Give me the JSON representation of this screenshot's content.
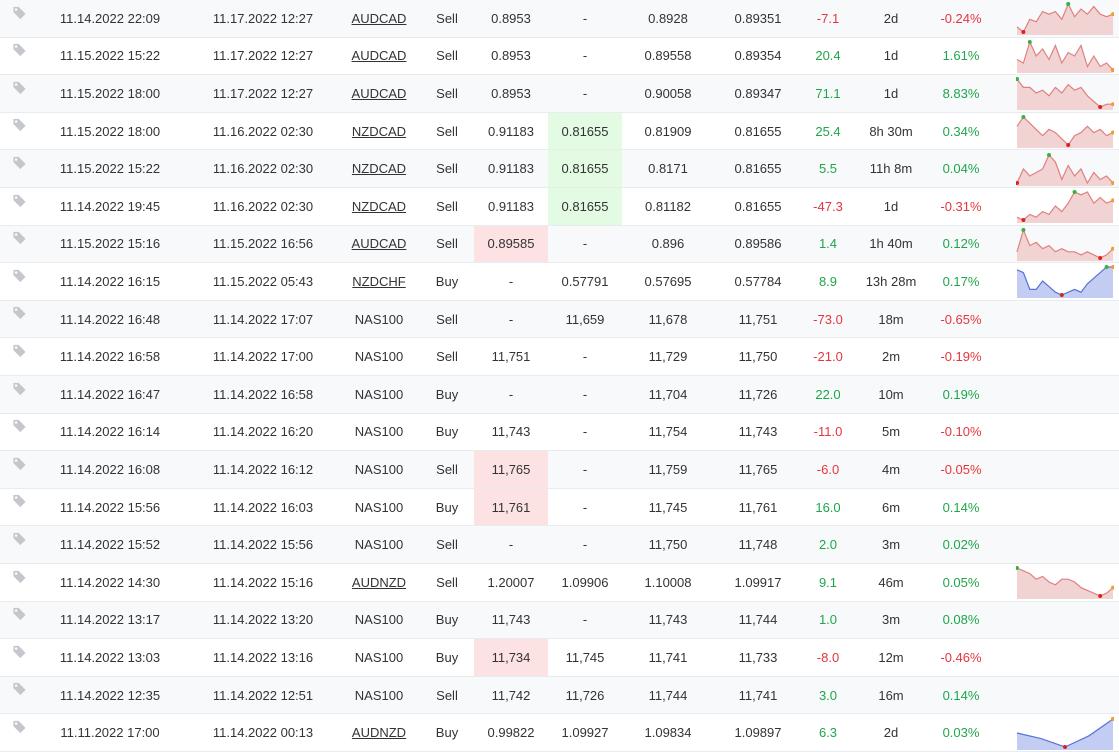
{
  "colors": {
    "positive": "#1fa64a",
    "negative": "#e5363d",
    "sl_highlight": "#fde2e3",
    "tp_highlight": "#e3fbe3",
    "spark_sell_fill": "#f2d3d3",
    "spark_sell_line": "#e08080",
    "spark_buy_fill": "#c3ccf2",
    "spark_buy_line": "#5a72d8",
    "spark_max_dot": "#3cb043",
    "spark_min_dot": "#e02020",
    "spark_end_dot": "#f0a030"
  },
  "row_icon": "tag-icon",
  "trades": [
    {
      "open_date": "11.14.2022 22:09",
      "close_date": "11.17.2022 12:27",
      "symbol": "AUDCAD",
      "symbol_link": true,
      "type": "Sell",
      "sl": "0.8953",
      "tp": "-",
      "open_price": "0.8928",
      "close_price": "0.89351",
      "pips": "-7.1",
      "duration": "2d",
      "gain": "-0.24%",
      "sl_hit": false,
      "tp_hit": false,
      "spark": [
        3,
        1,
        6,
        5,
        9,
        8,
        9,
        6,
        12,
        7,
        10,
        8,
        11,
        8,
        7,
        8
      ]
    },
    {
      "open_date": "11.15.2022 15:22",
      "close_date": "11.17.2022 12:27",
      "symbol": "AUDCAD",
      "symbol_link": true,
      "type": "Sell",
      "sl": "0.8953",
      "tp": "-",
      "open_price": "0.89558",
      "close_price": "0.89354",
      "pips": "20.4",
      "duration": "1d",
      "gain": "1.61%",
      "sl_hit": false,
      "tp_hit": false,
      "spark": [
        5,
        4,
        10,
        6,
        8,
        5,
        9,
        4,
        7,
        6,
        9,
        3,
        6,
        3,
        4,
        2
      ]
    },
    {
      "open_date": "11.15.2022 18:00",
      "close_date": "11.17.2022 12:27",
      "symbol": "AUDCAD",
      "symbol_link": true,
      "type": "Sell",
      "sl": "0.8953",
      "tp": "-",
      "open_price": "0.90058",
      "close_price": "0.89347",
      "pips": "71.1",
      "duration": "1d",
      "gain": "8.83%",
      "sl_hit": false,
      "tp_hit": false,
      "spark": [
        10,
        7,
        7,
        5,
        6,
        4,
        7,
        5,
        8,
        6,
        7,
        4,
        2,
        0,
        1,
        1
      ]
    },
    {
      "open_date": "11.15.2022 18:00",
      "close_date": "11.16.2022 02:30",
      "symbol": "NZDCAD",
      "symbol_link": true,
      "type": "Sell",
      "sl": "0.91183",
      "tp": "0.81655",
      "open_price": "0.81909",
      "close_price": "0.81655",
      "pips": "25.4",
      "duration": "8h 30m",
      "gain": "0.34%",
      "sl_hit": false,
      "tp_hit": true,
      "spark": [
        5,
        8,
        6,
        4,
        2,
        4,
        3,
        1,
        -1,
        2,
        3,
        5,
        3,
        4,
        2,
        3
      ]
    },
    {
      "open_date": "11.15.2022 15:22",
      "close_date": "11.16.2022 02:30",
      "symbol": "NZDCAD",
      "symbol_link": true,
      "type": "Sell",
      "sl": "0.91183",
      "tp": "0.81655",
      "open_price": "0.8171",
      "close_price": "0.81655",
      "pips": "5.5",
      "duration": "11h 8m",
      "gain": "0.04%",
      "sl_hit": false,
      "tp_hit": true,
      "spark": [
        2,
        6,
        4,
        5,
        6,
        10,
        8,
        3,
        7,
        4,
        6,
        2,
        5,
        3,
        4,
        2
      ]
    },
    {
      "open_date": "11.14.2022 19:45",
      "close_date": "11.16.2022 02:30",
      "symbol": "NZDCAD",
      "symbol_link": true,
      "type": "Sell",
      "sl": "0.91183",
      "tp": "0.81655",
      "open_price": "0.81182",
      "close_price": "0.81655",
      "pips": "-47.3",
      "duration": "1d",
      "gain": "-0.31%",
      "sl_hit": false,
      "tp_hit": true,
      "spark": [
        1,
        0,
        2,
        1,
        3,
        2,
        5,
        3,
        6,
        10,
        9,
        10,
        6,
        8,
        6,
        7
      ]
    },
    {
      "open_date": "11.15.2022 15:16",
      "close_date": "11.15.2022 16:56",
      "symbol": "AUDCAD",
      "symbol_link": true,
      "type": "Sell",
      "sl": "0.89585",
      "tp": "-",
      "open_price": "0.896",
      "close_price": "0.89586",
      "pips": "1.4",
      "duration": "1h 40m",
      "gain": "0.12%",
      "sl_hit": true,
      "tp_hit": false,
      "spark": [
        3,
        10,
        5,
        6,
        4,
        5,
        3,
        4,
        3,
        3,
        2,
        3,
        2,
        1,
        2,
        4
      ]
    },
    {
      "open_date": "11.14.2022 16:15",
      "close_date": "11.15.2022 05:43",
      "symbol": "NZDCHF",
      "symbol_link": true,
      "type": "Buy",
      "sl": "-",
      "tp": "0.57791",
      "open_price": "0.57695",
      "close_price": "0.57784",
      "pips": "8.9",
      "duration": "13h 28m",
      "gain": "0.17%",
      "sl_hit": false,
      "tp_hit": false,
      "spark": [
        9,
        8,
        2,
        2,
        5,
        3,
        1,
        0,
        1,
        2,
        1,
        4,
        6,
        8,
        10,
        10
      ]
    },
    {
      "open_date": "11.14.2022 16:48",
      "close_date": "11.14.2022 17:07",
      "symbol": "NAS100",
      "symbol_link": false,
      "type": "Sell",
      "sl": "-",
      "tp": "11,659",
      "open_price": "11,678",
      "close_price": "11,751",
      "pips": "-73.0",
      "duration": "18m",
      "gain": "-0.65%",
      "sl_hit": false,
      "tp_hit": false,
      "spark": null
    },
    {
      "open_date": "11.14.2022 16:58",
      "close_date": "11.14.2022 17:00",
      "symbol": "NAS100",
      "symbol_link": false,
      "type": "Sell",
      "sl": "11,751",
      "tp": "-",
      "open_price": "11,729",
      "close_price": "11,750",
      "pips": "-21.0",
      "duration": "2m",
      "gain": "-0.19%",
      "sl_hit": false,
      "tp_hit": false,
      "spark": null
    },
    {
      "open_date": "11.14.2022 16:47",
      "close_date": "11.14.2022 16:58",
      "symbol": "NAS100",
      "symbol_link": false,
      "type": "Buy",
      "sl": "-",
      "tp": "-",
      "open_price": "11,704",
      "close_price": "11,726",
      "pips": "22.0",
      "duration": "10m",
      "gain": "0.19%",
      "sl_hit": false,
      "tp_hit": false,
      "spark": null
    },
    {
      "open_date": "11.14.2022 16:14",
      "close_date": "11.14.2022 16:20",
      "symbol": "NAS100",
      "symbol_link": false,
      "type": "Buy",
      "sl": "11,743",
      "tp": "-",
      "open_price": "11,754",
      "close_price": "11,743",
      "pips": "-11.0",
      "duration": "5m",
      "gain": "-0.10%",
      "sl_hit": false,
      "tp_hit": false,
      "spark": null
    },
    {
      "open_date": "11.14.2022 16:08",
      "close_date": "11.14.2022 16:12",
      "symbol": "NAS100",
      "symbol_link": false,
      "type": "Sell",
      "sl": "11,765",
      "tp": "-",
      "open_price": "11,759",
      "close_price": "11,765",
      "pips": "-6.0",
      "duration": "4m",
      "gain": "-0.05%",
      "sl_hit": true,
      "tp_hit": false,
      "spark": null
    },
    {
      "open_date": "11.14.2022 15:56",
      "close_date": "11.14.2022 16:03",
      "symbol": "NAS100",
      "symbol_link": false,
      "type": "Buy",
      "sl": "11,761",
      "tp": "-",
      "open_price": "11,745",
      "close_price": "11,761",
      "pips": "16.0",
      "duration": "6m",
      "gain": "0.14%",
      "sl_hit": true,
      "tp_hit": false,
      "spark": null
    },
    {
      "open_date": "11.14.2022 15:52",
      "close_date": "11.14.2022 15:56",
      "symbol": "NAS100",
      "symbol_link": false,
      "type": "Sell",
      "sl": "-",
      "tp": "-",
      "open_price": "11,750",
      "close_price": "11,748",
      "pips": "2.0",
      "duration": "3m",
      "gain": "0.02%",
      "sl_hit": false,
      "tp_hit": false,
      "spark": null
    },
    {
      "open_date": "11.14.2022 14:30",
      "close_date": "11.14.2022 15:16",
      "symbol": "AUDNZD",
      "symbol_link": true,
      "type": "Sell",
      "sl": "1.20007",
      "tp": "1.09906",
      "open_price": "1.10008",
      "close_price": "1.09917",
      "pips": "9.1",
      "duration": "46m",
      "gain": "0.05%",
      "sl_hit": false,
      "tp_hit": false,
      "spark": [
        10,
        9,
        8,
        6,
        7,
        5,
        4,
        6,
        6,
        5,
        3,
        2,
        1,
        0,
        1,
        3
      ]
    },
    {
      "open_date": "11.14.2022 13:17",
      "close_date": "11.14.2022 13:20",
      "symbol": "NAS100",
      "symbol_link": false,
      "type": "Buy",
      "sl": "11,743",
      "tp": "-",
      "open_price": "11,743",
      "close_price": "11,744",
      "pips": "1.0",
      "duration": "3m",
      "gain": "0.08%",
      "sl_hit": false,
      "tp_hit": false,
      "spark": null
    },
    {
      "open_date": "11.14.2022 13:03",
      "close_date": "11.14.2022 13:16",
      "symbol": "NAS100",
      "symbol_link": false,
      "type": "Buy",
      "sl": "11,734",
      "tp": "11,745",
      "open_price": "11,741",
      "close_price": "11,733",
      "pips": "-8.0",
      "duration": "12m",
      "gain": "-0.46%",
      "sl_hit": true,
      "tp_hit": false,
      "spark": null
    },
    {
      "open_date": "11.14.2022 12:35",
      "close_date": "11.14.2022 12:51",
      "symbol": "NAS100",
      "symbol_link": false,
      "type": "Sell",
      "sl": "11,742",
      "tp": "11,726",
      "open_price": "11,744",
      "close_price": "11,741",
      "pips": "3.0",
      "duration": "16m",
      "gain": "0.14%",
      "sl_hit": false,
      "tp_hit": false,
      "spark": null
    },
    {
      "open_date": "11.11.2022 17:00",
      "close_date": "11.14.2022 00:13",
      "symbol": "AUDNZD",
      "symbol_link": true,
      "type": "Buy",
      "sl": "0.99822",
      "tp": "1.09927",
      "open_price": "1.09834",
      "close_price": "1.09897",
      "pips": "6.3",
      "duration": "2d",
      "gain": "0.03%",
      "sl_hit": false,
      "tp_hit": false,
      "spark": [
        5,
        3,
        0,
        4,
        10
      ]
    }
  ]
}
